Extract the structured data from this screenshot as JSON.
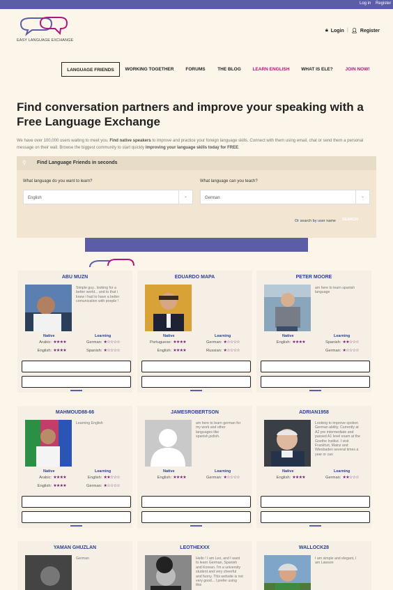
{
  "topbar": {
    "login": "Log in",
    "register": "Register"
  },
  "header": {
    "logo_text": "EASY LANGUAGE EXCHANGE",
    "login": "Login",
    "register": "Register"
  },
  "nav": [
    "LANGUAGE FRIENDS",
    "WORKING TOGETHER",
    "FORUMS",
    "THE BLOG",
    "LEARN ENGLISH",
    "WHAT IS ELE?",
    "JOIN NOW!"
  ],
  "title": "Find conversation partners and improve your speaking with a Free Language Exchange",
  "intro": {
    "p1": "We have over 100,000 users waiting to meet you. ",
    "b1": "Find native speakers",
    "p2": " to improve and practice your foreign language skills. Connect with them using email, chat or send them a personal message on their wall. Browse the biggest community to start quickly ",
    "b2": "improving your language skills today for FREE",
    "p3": "."
  },
  "search": {
    "heading": "Find Language Friends in seconds",
    "learn_label": "What language do you want to learn?",
    "learn_value": "English",
    "teach_label": "What language can you teach?",
    "teach_value": "German",
    "by_name": "Or search by user name",
    "button": "SEARCH"
  },
  "cards_labels": {
    "native": "Native",
    "learning": "Learning",
    "btn1": "",
    "btn2": ""
  },
  "colors": {
    "accent": "#5b5ea6",
    "pink": "#b4157a",
    "name": "#2a3f8f",
    "star": "#7a1a7a"
  },
  "cards": [
    {
      "name": "ABU MUZN",
      "bio": "Simple guy.. looking for a better world... and to that i knew i had to have a better comunication with poeple !",
      "native": [
        {
          "lang": "Arabic:",
          "stars": "★★★★"
        },
        {
          "lang": "English:",
          "stars": "★★★★"
        }
      ],
      "learning": [
        {
          "lang": "German:",
          "stars": "★☆☆☆☆"
        },
        {
          "lang": "Spanish:",
          "stars": "★☆☆☆☆"
        }
      ]
    },
    {
      "name": "EDUARDO MAPA",
      "bio": "",
      "native": [
        {
          "lang": "Portuguese:",
          "stars": "★★★★"
        },
        {
          "lang": "English:",
          "stars": "★★★★"
        }
      ],
      "learning": [
        {
          "lang": "German:",
          "stars": "★☆☆☆☆"
        },
        {
          "lang": "Russian:",
          "stars": "★☆☆☆☆"
        }
      ]
    },
    {
      "name": "PETER MOORE",
      "bio": "am here to learn spanish language",
      "native": [
        {
          "lang": "English:",
          "stars": "★★★★"
        }
      ],
      "learning": [
        {
          "lang": "Spanish:",
          "stars": "★★☆☆☆"
        },
        {
          "lang": "German:",
          "stars": "★☆☆☆☆"
        }
      ]
    },
    {
      "name": "MAHMOUD88-66",
      "bio": "Learning English",
      "native": [
        {
          "lang": "Arabic:",
          "stars": "★★★★"
        },
        {
          "lang": "English:",
          "stars": "★★★★"
        }
      ],
      "learning": [
        {
          "lang": "English:",
          "stars": "★★☆☆☆"
        },
        {
          "lang": "German:",
          "stars": "★☆☆☆☆"
        }
      ]
    },
    {
      "name": "JAMESROBERTSON",
      "bio": "am here to learn german for my work and other languages like spanish,polish.",
      "native": [
        {
          "lang": "English:",
          "stars": "★★★★"
        }
      ],
      "learning": [
        {
          "lang": "German:",
          "stars": "★☆☆☆☆"
        }
      ]
    },
    {
      "name": "ADRIAN1958",
      "bio": "Looking to improve spoken German ability. Currently at A2 pre intermediate and passed A1 level exam at the Goethe Institut. I visit Frankfurt, Mainz and Wiesbaden several times a year or can",
      "native": [
        {
          "lang": "English:",
          "stars": "★★★★"
        }
      ],
      "learning": [
        {
          "lang": "German:",
          "stars": "★★☆☆☆"
        }
      ]
    },
    {
      "name": "YAMAN GHUZLAN",
      "bio": "German",
      "native": [],
      "learning": []
    },
    {
      "name": "LEOTHEXXX",
      "bio": "Hello ! I am Leo, and I want to learn German, Spanish and Korean. I'm a university student and very cheerful and funny. This website is not very good... I prefer using this",
      "native": [],
      "learning": []
    },
    {
      "name": "WALLOCK28",
      "bio": "I am simple and elegant, I am Lawson",
      "native": [],
      "learning": []
    }
  ]
}
